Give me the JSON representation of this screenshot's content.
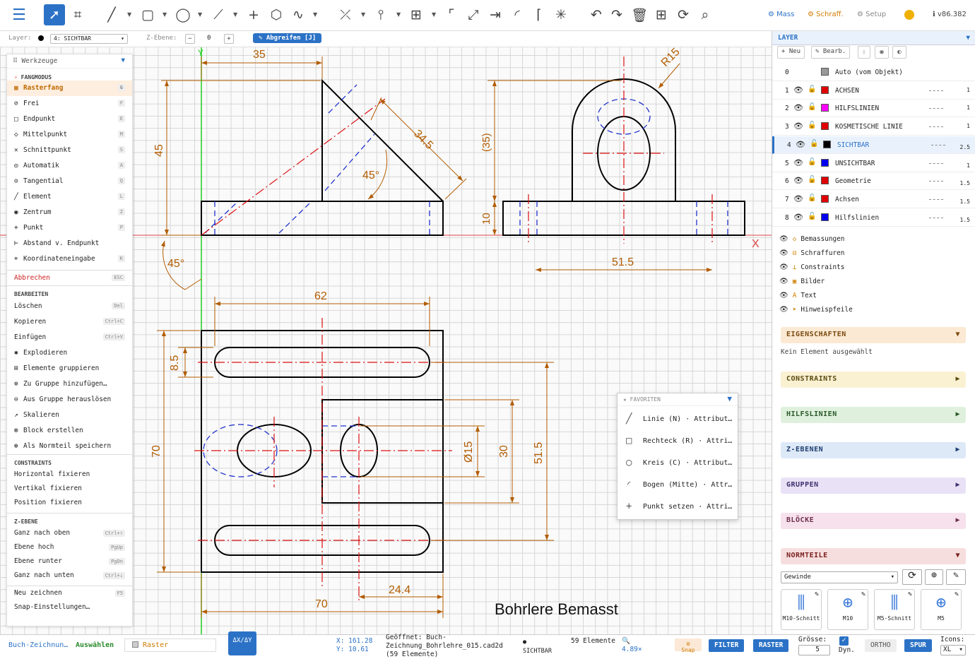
{
  "toolbar": {
    "menu_icon": "hamburger-icon",
    "tools": [
      "select-arrow-icon",
      "measure-icon",
      "line-icon",
      "rectangle-icon",
      "circle-icon",
      "polyline-icon",
      "point-icon",
      "polygon-icon",
      "spline-icon",
      "trim-icon",
      "mirror-icon",
      "array-icon",
      "fillet-icon",
      "scale-icon",
      "move-icon",
      "arc-icon",
      "chamfer-icon",
      "explode-icon",
      "undo-icon",
      "redo-icon",
      "delete-icon",
      "grid-icon",
      "refresh-icon",
      "zoom-icon"
    ],
    "mass_label": "Mass",
    "schraff_label": "Schraff.",
    "setup_label": "Setup",
    "version": "v86.382"
  },
  "layerbar": {
    "layer_label": "Layer:",
    "layer_value": "4: SICHTBAR",
    "zebene_label": "Z-Ebene:",
    "zebene_value": "0",
    "grab_label": "Abgreifen [J]"
  },
  "tools_panel": {
    "title": "Werkzeuge",
    "fang_title": "FANGMODUS",
    "items_fang": [
      {
        "label": "Rasterfang",
        "key": "G"
      },
      {
        "label": "Frei",
        "key": "F"
      },
      {
        "label": "Endpunkt",
        "key": "E"
      },
      {
        "label": "Mittelpunkt",
        "key": "M"
      },
      {
        "label": "Schnittpunkt",
        "key": "S"
      },
      {
        "label": "Automatik",
        "key": "A"
      },
      {
        "label": "Tangential",
        "key": "Q"
      },
      {
        "label": "Element",
        "key": "L"
      },
      {
        "label": "Zentrum",
        "key": "Z"
      },
      {
        "label": "Punkt",
        "key": "P"
      },
      {
        "label": "Abstand v. Endpunkt",
        "key": ""
      },
      {
        "label": "Koordinateneingabe",
        "key": "K"
      }
    ],
    "abort": {
      "label": "Abbrechen",
      "key": "ESC"
    },
    "bearb_title": "BEARBEITEN",
    "items_bearb": [
      {
        "label": "Löschen",
        "key": "Del"
      },
      {
        "label": "Kopieren",
        "key": "Ctrl+C"
      },
      {
        "label": "Einfügen",
        "key": "Ctrl+V"
      },
      {
        "label": "Explodieren",
        "key": ""
      },
      {
        "label": "Elemente gruppieren",
        "key": ""
      },
      {
        "label": "Zu Gruppe hinzufügen…",
        "key": ""
      },
      {
        "label": "Aus Gruppe herauslösen",
        "key": ""
      },
      {
        "label": "Skalieren",
        "key": ""
      },
      {
        "label": "Block erstellen",
        "key": ""
      },
      {
        "label": "Als Normteil speichern",
        "key": ""
      }
    ],
    "constr_title": "CONSTRAINTS",
    "items_constr": [
      {
        "label": "Horizontal fixieren"
      },
      {
        "label": "Vertikal fixieren"
      },
      {
        "label": "Position fixieren"
      }
    ],
    "zebene_title": "Z-EBENE",
    "items_z": [
      {
        "label": "Ganz nach oben",
        "key": "Ctrl+↑"
      },
      {
        "label": "Ebene hoch",
        "key": "PgUp"
      },
      {
        "label": "Ebene runter",
        "key": "PgDn"
      },
      {
        "label": "Ganz nach unten",
        "key": "Ctrl+↓"
      }
    ],
    "items_misc": [
      {
        "label": "Neu zeichnen",
        "key": "F5"
      },
      {
        "label": "Snap-Einstellungen…",
        "key": ""
      }
    ]
  },
  "drawing": {
    "dims": [
      "35",
      "45",
      "34.5",
      "45°",
      "10",
      "45°",
      "R15",
      "(35)",
      "51.5",
      "62",
      "8.5",
      "70",
      "Ø15",
      "30",
      "51.5",
      "24.4",
      "70"
    ],
    "axis_x": "X",
    "axis_y": "Y",
    "caption": "Bohrlere Bemasst"
  },
  "favorites": {
    "title": "FAVORITEN",
    "items": [
      "Linie (N) · Attribut…",
      "Rechteck (R) · Attri…",
      "Kreis (C) · Attribut…",
      "Bogen (Mitte) · Attr…",
      "Punkt setzen · Attri…"
    ]
  },
  "right_panel": {
    "layer_title": "LAYER",
    "buttons": [
      "+ Neu",
      "Bearb."
    ],
    "layers": [
      {
        "num": "0",
        "name": "Auto (vom Objekt)",
        "color": "#999999",
        "w": ""
      },
      {
        "num": "1",
        "name": "ACHSEN",
        "color": "#e00000",
        "w": "1"
      },
      {
        "num": "2",
        "name": "HILFSLINIEN",
        "color": "#ff00ff",
        "w": "1"
      },
      {
        "num": "3",
        "name": "KOSMETISCHE LINIE",
        "color": "#e00000",
        "w": "1"
      },
      {
        "num": "4",
        "name": "SICHTBAR",
        "color": "#000000",
        "w": "2.5"
      },
      {
        "num": "5",
        "name": "UNSICHTBAR",
        "color": "#0000ee",
        "w": "1"
      },
      {
        "num": "6",
        "name": "Geometrie",
        "color": "#e00000",
        "w": "1.5"
      },
      {
        "num": "7",
        "name": "Achsen",
        "color": "#e00000",
        "w": "1.5"
      },
      {
        "num": "8",
        "name": "Hilfslinien",
        "color": "#0000ee",
        "w": "1.5"
      }
    ],
    "groups": [
      "Bemassungen",
      "Schraffuren",
      "Constraints",
      "Bilder",
      "Text",
      "Hinweispfeile"
    ],
    "props_title": "EIGENSCHAFTEN",
    "props_text": "Kein Element ausgewählt",
    "sections": [
      "CONSTRAINTS",
      "HILFSLINIEN",
      "Z-EBENEN",
      "GRUPPEN",
      "BLÖCKE"
    ],
    "normteile_title": "NORMTEILE",
    "normteile_select": "Gewinde",
    "tiles": [
      "M10-Schnitt",
      "M10",
      "M5-Schnitt",
      "M5"
    ]
  },
  "status": {
    "file": "Buch-Zeichnun…",
    "mode": "Auswählen",
    "snap": "Raster",
    "dxdy": "ΔX/ΔY",
    "x": "X: 161.28",
    "y": "Y: 10.61",
    "opened": "Geöffnet: Buch-Zeichnung_Bohrlehre_015.cad2d (59 Elemente)",
    "layer": "SICHTBAR",
    "elements": "59 Elemente",
    "zoom": "4.89×",
    "snap_btn": "Snap",
    "filter": "FILTER",
    "raster": "RASTER",
    "groesse_label": "Grösse:",
    "groesse": "5",
    "dyn": "Dyn.",
    "ortho": "ORTHO",
    "spur": "SPUR",
    "icons_label": "Icons:",
    "icons_value": "XL"
  }
}
